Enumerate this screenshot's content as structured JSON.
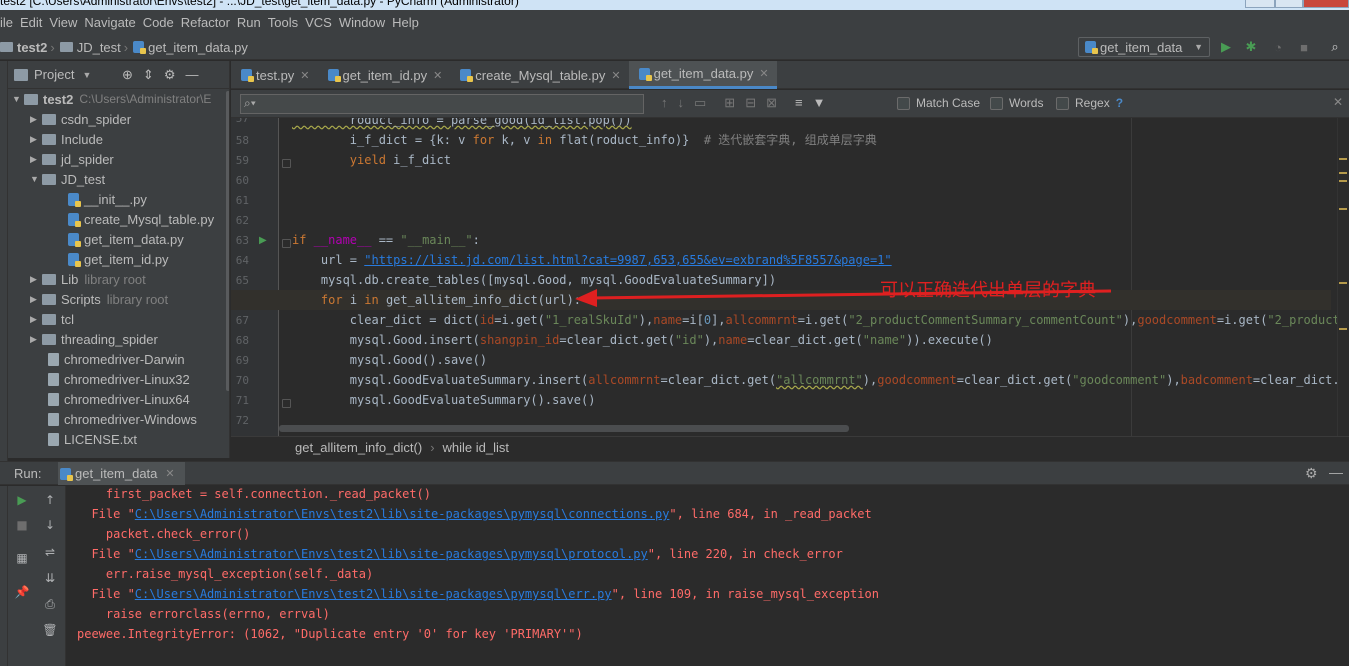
{
  "window": {
    "title": "test2 [C:\\Users\\Administrator\\Envs\\test2] - ...\\JD_test\\get_item_data.py - PyCharm (Administrator)"
  },
  "menu": [
    "ile",
    "Edit",
    "View",
    "Navigate",
    "Code",
    "Refactor",
    "Run",
    "Tools",
    "VCS",
    "Window",
    "Help"
  ],
  "breadcrumbs": [
    "test2",
    "JD_test",
    "get_item_data.py"
  ],
  "run_config": "get_item_data",
  "project_panel": {
    "title": "Project",
    "root_name": "test2",
    "root_path": "C:\\Users\\Administrator\\E",
    "items": [
      {
        "label": "csdn_spider",
        "hint": ""
      },
      {
        "label": "Include",
        "hint": ""
      },
      {
        "label": "jd_spider",
        "hint": ""
      },
      {
        "label": "JD_test",
        "hint": ""
      },
      {
        "label": "__init__.py",
        "hint": ""
      },
      {
        "label": "create_Mysql_table.py",
        "hint": ""
      },
      {
        "label": "get_item_data.py",
        "hint": ""
      },
      {
        "label": "get_item_id.py",
        "hint": ""
      },
      {
        "label": "Lib",
        "hint": "library root"
      },
      {
        "label": "Scripts",
        "hint": "library root"
      },
      {
        "label": "tcl",
        "hint": ""
      },
      {
        "label": "threading_spider",
        "hint": ""
      },
      {
        "label": "chromedriver-Darwin",
        "hint": ""
      },
      {
        "label": "chromedriver-Linux32",
        "hint": ""
      },
      {
        "label": "chromedriver-Linux64",
        "hint": ""
      },
      {
        "label": "chromedriver-Windows",
        "hint": ""
      },
      {
        "label": "LICENSE.txt",
        "hint": ""
      }
    ]
  },
  "tabs": [
    "test.py",
    "get_item_id.py",
    "create_Mysql_table.py",
    "get_item_data.py"
  ],
  "find": {
    "match_case": "Match Case",
    "words": "Words",
    "regex": "Regex",
    "help": "?"
  },
  "line_numbers": [
    "57",
    "58",
    "59",
    "60",
    "61",
    "62",
    "63",
    "64",
    "65",
    "66",
    "67",
    "68",
    "69",
    "70",
    "71",
    "72"
  ],
  "code": {
    "l57": "        roduct_info = parse_good(id_list.pop())",
    "l58_a": "        i_f_dict = {k: v ",
    "l58_for": "for",
    "l58_b": " k, v ",
    "l58_in": "in",
    "l58_c": " flat(roduct_info)}  ",
    "l58_cmt": "# 迭代嵌套字典, 组成单层字典",
    "l59_kw": "yield",
    "l59_rest": " i_f_dict",
    "l63_if": "if",
    "l63_name": " __name__ ",
    "l63_eq": "== ",
    "l63_main": "\"__main__\"",
    "l63_colon": ":",
    "l64_a": "    url = ",
    "l64_url": "\"https://list.jd.com/list.html?cat=9987,653,655&ev=exbrand%5F8557&page=1\"",
    "l65": "    mysql.db.create_tables([mysql.Good, mysql.GoodEvaluateSummary])",
    "l66_for": "for",
    "l66_i": " i ",
    "l66_in": "in",
    "l66_rest": " get_allitem_info_dict(url):",
    "l67_a": "        clear_dict = dict(",
    "l67_p1": "id",
    "l67_b": "=i.get(",
    "l67_s1": "\"1_realSkuId\"",
    "l67_c": "),",
    "l67_p2": "name",
    "l67_d": "=i[",
    "l67_n0": "0",
    "l67_e": "],",
    "l67_p3": "allcommrnt",
    "l67_f": "=i.get(",
    "l67_s2": "\"2_productCommentSummary_commentCount\"",
    "l67_g": "),",
    "l67_p4": "goodcomment",
    "l67_h": "=i.get(",
    "l67_s3": "\"2_productCommen",
    "l68_a": "        mysql.Good.insert(",
    "l68_p1": "shangpin_id",
    "l68_b": "=clear_dict.get(",
    "l68_s1": "\"id\"",
    "l68_c": "),",
    "l68_p2": "name",
    "l68_d": "=clear_dict.get(",
    "l68_s2": "\"name\"",
    "l68_e": ")).execute()",
    "l69": "        mysql.Good().save()",
    "l70_a": "        mysql.GoodEvaluateSummary.insert(",
    "l70_p1": "allcommrnt",
    "l70_b": "=clear_dict.get(",
    "l70_s1": "\"allcommrnt\"",
    "l70_c": "),",
    "l70_p2": "goodcomment",
    "l70_d": "=clear_dict.get(",
    "l70_s2": "\"goodcomment\"",
    "l70_e": "),",
    "l70_p3": "badcomment",
    "l70_f": "=clear_dict.get(",
    "l70_s3": "\"b",
    "l71": "        mysql.GoodEvaluateSummary().save()"
  },
  "annotation": "可以正确迭代出单层的字典",
  "editor_breadcrumbs": [
    "get_allitem_info_dict()",
    "while id_list"
  ],
  "run_panel": {
    "label": "Run:",
    "tab": "get_item_data"
  },
  "console": {
    "l1": "    first_packet = self.connection._read_packet()",
    "l2_a": "  File \"",
    "l2_link": "C:\\Users\\Administrator\\Envs\\test2\\lib\\site-packages\\pymysql\\connections.py",
    "l2_b": "\", line 684, in _read_packet",
    "l3": "    packet.check_error()",
    "l4_a": "  File \"",
    "l4_link": "C:\\Users\\Administrator\\Envs\\test2\\lib\\site-packages\\pymysql\\protocol.py",
    "l4_b": "\", line 220, in check_error",
    "l5": "    err.raise_mysql_exception(self._data)",
    "l6_a": "  File \"",
    "l6_link": "C:\\Users\\Administrator\\Envs\\test2\\lib\\site-packages\\pymysql\\err.py",
    "l6_b": "\", line 109, in raise_mysql_exception",
    "l7": "    raise errorclass(errno, errval)",
    "l8": "peewee.IntegrityError: (1062, \"Duplicate entry '0' for key 'PRIMARY'\")"
  },
  "colors": {
    "keyword": "#cc7832",
    "string": "#6a8759",
    "error_text": "#ff6b68",
    "link": "#287bde",
    "annotation": "#e02020"
  }
}
